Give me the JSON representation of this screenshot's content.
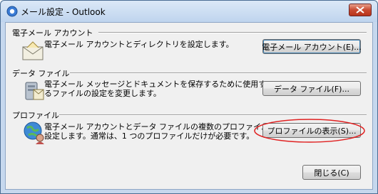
{
  "window": {
    "title": "メール設定 - Outlook"
  },
  "sections": [
    {
      "title": "電子メール アカウント",
      "description": "電子メール アカウントとディレクトリを設定します。",
      "button_label": "電子メール アカウント(E)..."
    },
    {
      "title": "データ ファイル",
      "description_line1": "電子メール メッセージとドキュメントを保存するために使用す",
      "description_line2": "るファイルの設定を変更します。",
      "button_label": "データ ファイル(F)..."
    },
    {
      "title": "プロファイル",
      "description_line1": "電子メール アカウントとデータ ファイルの複数のプロファイルを",
      "description_line2": "設定します。通常は、1 つのプロファイルだけが必要です。",
      "button_label": "プロファイルの表示(S)..."
    }
  ],
  "footer": {
    "close_label": "閉じる(C)"
  },
  "colors": {
    "highlight_ellipse": "#e02020"
  }
}
